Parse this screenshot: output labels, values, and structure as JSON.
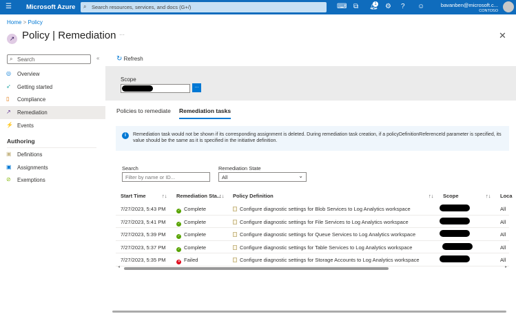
{
  "topbar": {
    "brand": "Microsoft Azure",
    "search_placeholder": "Search resources, services, and docs (G+/)",
    "notifications": "1",
    "user": "bavanben@microsoft.c...",
    "tenant": "CONTOSO"
  },
  "breadcrumb": {
    "home": "Home",
    "sep": ">",
    "policy": "Policy"
  },
  "title": "Policy | Remediation",
  "more": "···",
  "sidebar": {
    "search_placeholder": "Search",
    "items": [
      {
        "label": "Overview"
      },
      {
        "label": "Getting started"
      },
      {
        "label": "Compliance"
      },
      {
        "label": "Remediation"
      },
      {
        "label": "Events"
      }
    ],
    "section": "Authoring",
    "authoring": [
      {
        "label": "Definitions"
      },
      {
        "label": "Assignments"
      },
      {
        "label": "Exemptions"
      }
    ]
  },
  "toolbar": {
    "refresh": "Refresh"
  },
  "scope": {
    "label": "Scope",
    "button": "..."
  },
  "tabs": [
    {
      "label": "Policies to remediate"
    },
    {
      "label": "Remediation tasks"
    }
  ],
  "info": "Remediation task would not be shown if its corresponding assignment is deleted. During remediation task creation, if a policyDefinitionReferenceId parameter is specified, its value should be the same as it is specified in the initiative definition.",
  "filters": {
    "search_label": "Search",
    "search_placeholder": "Filter by name or ID...",
    "state_label": "Remediation State",
    "state_value": "All"
  },
  "table": {
    "columns": [
      "Start Time",
      "Remediation Sta...",
      "Policy Definition",
      "Scope",
      "Loca"
    ],
    "rows": [
      {
        "time": "7/27/2023, 5:43 PM",
        "state": "Complete",
        "policy": "Configure diagnostic settings for Blob Services to Log Analytics workspace",
        "loc": "All"
      },
      {
        "time": "7/27/2023, 5:41 PM",
        "state": "Complete",
        "policy": "Configure diagnostic settings for File Services to Log Analytics workspace",
        "loc": "All"
      },
      {
        "time": "7/27/2023, 5:39 PM",
        "state": "Complete",
        "policy": "Configure diagnostic settings for Queue Services to Log Analytics workspace",
        "loc": "All"
      },
      {
        "time": "7/27/2023, 5:37 PM",
        "state": "Complete",
        "policy": "Configure diagnostic settings for Table Services to Log Analytics workspace",
        "loc": "All"
      },
      {
        "time": "7/27/2023, 5:35 PM",
        "state": "Failed",
        "policy": "Configure diagnostic settings for Storage Accounts to Log Analytics workspace",
        "loc": "All"
      }
    ]
  },
  "colors": {
    "brand": "#0f6cbd",
    "complete": "#57a300",
    "failed": "#e00b1c"
  }
}
